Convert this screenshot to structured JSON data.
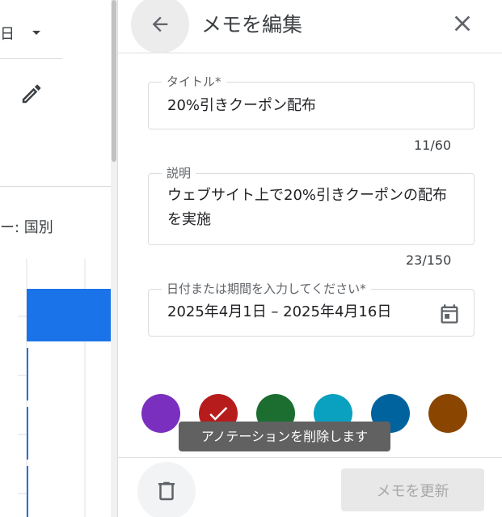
{
  "left_pane": {
    "period_label": "日",
    "chart_title": "ー: 国別"
  },
  "panel": {
    "title": "メモを編集",
    "fields": {
      "title": {
        "label": "タイトル*",
        "value": "20%引きクーポン配布",
        "counter": "11/60"
      },
      "description": {
        "label": "説明",
        "value": "ウェブサイト上で20%引きクーポンの配布を実施",
        "counter": "23/150"
      },
      "date": {
        "label": "日付または期間を入力してください*",
        "value": "2025年4月1日 – 2025年4月16日"
      }
    },
    "colors": [
      {
        "name": "purple",
        "hex": "#7b2fbe",
        "selected": false
      },
      {
        "name": "red",
        "hex": "#b71c1c",
        "selected": true
      },
      {
        "name": "green",
        "hex": "#1b6e2f",
        "selected": false
      },
      {
        "name": "cyan",
        "hex": "#0aa0bf",
        "selected": false
      },
      {
        "name": "blue",
        "hex": "#00639e",
        "selected": false
      },
      {
        "name": "brown",
        "hex": "#8a4600",
        "selected": false
      }
    ],
    "tooltip": "アノテーションを削除します",
    "update_button": "メモを更新"
  },
  "theme": {
    "bar_color": "#1a73e8"
  }
}
